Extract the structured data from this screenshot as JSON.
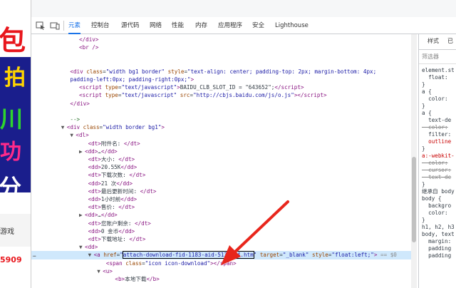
{
  "left_page": {
    "chars": [
      "包",
      "拍",
      "川",
      "功",
      "分"
    ],
    "button": "游戏",
    "number": "5909"
  },
  "toolbar": {
    "tabs": [
      "元素",
      "控制台",
      "源代码",
      "网络",
      "性能",
      "内存",
      "应用程序",
      "安全",
      "Lighthouse"
    ],
    "active": "元素"
  },
  "elements": {
    "lines": [
      {
        "indent": 10,
        "html": "&lt;/div&gt;",
        "type": "tag"
      },
      {
        "indent": 10,
        "html": "&lt;br /&gt;",
        "type": "tag"
      },
      {
        "indent": 0,
        "html": "",
        "type": "blank"
      },
      {
        "indent": 0,
        "html": "",
        "type": "blank"
      },
      {
        "indent": 8,
        "html": "<span class='tag'>&lt;div</span> <span class='attr'>class</span>=<span class='val'>\"width bg1 border\"</span> <span class='attr'>style</span>=<span class='val'>\"text-align: center; padding-top: 2px; margin-bottom: 4px;</span>",
        "type": "raw"
      },
      {
        "indent": 8,
        "html": "<span class='val'>padding-left:0px; padding-right:0px;\"</span><span class='tag'>&gt;</span>",
        "type": "raw"
      },
      {
        "indent": 10,
        "html": "<span class='tag'>&lt;script</span> <span class='attr'>type</span>=<span class='val'>\"text/javascript\"</span><span class='tag'>&gt;</span>BAIDU_CLB_SLOT_ID = \"643652\";<span class='tag'>&lt;/script&gt;</span>",
        "type": "raw"
      },
      {
        "indent": 10,
        "html": "<span class='tag'>&lt;script</span> <span class='attr'>type</span>=<span class='val'>\"text/javascript\"</span> <span class='attr'>src</span>=<span class='val'>\"http://cbjs.baidu.com/js/o.js\"</span><span class='tag'>&gt;&lt;/script&gt;</span>",
        "type": "raw"
      },
      {
        "indent": 8,
        "html": "<span class='tag'>&lt;/div&gt;</span>",
        "type": "raw"
      },
      {
        "indent": 0,
        "html": "",
        "type": "blank"
      },
      {
        "indent": 8,
        "html": "<span class='cmt'>--&gt;</span>",
        "type": "raw"
      },
      {
        "indent": 6,
        "html": "<span class='tri'>▼</span><span class='tag'>&lt;div</span> <span class='attr'>class</span>=<span class='val'>\"width border bg1\"</span><span class='tag'>&gt;</span>",
        "type": "raw"
      },
      {
        "indent": 8,
        "html": "<span class='tri'>▼</span><span class='tag'>&lt;dl&gt;</span>",
        "type": "raw"
      },
      {
        "indent": 12,
        "html": "<span class='tag'>&lt;dt&gt;</span>附件名: <span class='tag'>&lt;/dt&gt;</span>",
        "type": "raw"
      },
      {
        "indent": 10,
        "html": "<span class='tri'>▶</span><span class='tag'>&lt;dd&gt;</span>…<span class='tag'>&lt;/dd&gt;</span>",
        "type": "raw"
      },
      {
        "indent": 12,
        "html": "<span class='tag'>&lt;dt&gt;</span>大小: <span class='tag'>&lt;/dt&gt;</span>",
        "type": "raw"
      },
      {
        "indent": 12,
        "html": "<span class='tag'>&lt;dd&gt;</span>20.55K<span class='tag'>&lt;/dd&gt;</span>",
        "type": "raw"
      },
      {
        "indent": 12,
        "html": "<span class='tag'>&lt;dt&gt;</span>下载次数: <span class='tag'>&lt;/dt&gt;</span>",
        "type": "raw"
      },
      {
        "indent": 12,
        "html": "<span class='tag'>&lt;dd&gt;</span>21 次<span class='tag'>&lt;/dd&gt;</span>",
        "type": "raw"
      },
      {
        "indent": 12,
        "html": "<span class='tag'>&lt;dt&gt;</span>最后更新时间: <span class='tag'>&lt;/dt&gt;</span>",
        "type": "raw"
      },
      {
        "indent": 12,
        "html": "<span class='tag'>&lt;dd&gt;</span>1小时前<span class='tag'>&lt;/dd&gt;</span>",
        "type": "raw"
      },
      {
        "indent": 12,
        "html": "<span class='tag'>&lt;dt&gt;</span>售价: <span class='tag'>&lt;/dt&gt;</span>",
        "type": "raw"
      },
      {
        "indent": 10,
        "html": "<span class='tri'>▶</span><span class='tag'>&lt;dd&gt;</span>…<span class='tag'>&lt;/dd&gt;</span>",
        "type": "raw"
      },
      {
        "indent": 12,
        "html": "<span class='tag'>&lt;dt&gt;</span>您账户剩余: <span class='tag'>&lt;/dt&gt;</span>",
        "type": "raw"
      },
      {
        "indent": 12,
        "html": "<span class='tag'>&lt;dd&gt;</span>0 金币<span class='tag'>&lt;/dd&gt;</span>",
        "type": "raw"
      },
      {
        "indent": 12,
        "html": "<span class='tag'>&lt;dt&gt;</span>下载地址: <span class='tag'>&lt;/dt&gt;</span>",
        "type": "raw"
      },
      {
        "indent": 10,
        "html": "<span class='tri'>▼</span><span class='tag'>&lt;dd&gt;</span>",
        "type": "raw"
      },
      {
        "indent": 12,
        "html": "<span class='tri'>▼</span><span class='tag'>&lt;a</span> <span class='attr'>href</span>=<span class='val'>\"<span class='highlight-box'>attach-download-fid-1183-aid-5138184.htm</span>\"</span> <span class='attr'>target</span>=<span class='val'>\"_blank\"</span> <span class='attr'>style</span>=<span class='val'>\"float:left;\"</span><span class='tag'>&gt;</span> <span style='color:#888'>== $0</span>",
        "type": "selected"
      },
      {
        "indent": 16,
        "html": "<span class='tag'>&lt;span</span> <span class='attr'>class</span>=<span class='val'>\"icon icon-download\"</span><span class='tag'>&gt;&lt;/span&gt;</span>",
        "type": "raw"
      },
      {
        "indent": 14,
        "html": "<span class='tri'>▼</span><span class='tag'>&lt;u&gt;</span>",
        "type": "raw"
      },
      {
        "indent": 18,
        "html": "<span class='tag'>&lt;b&gt;</span>本地下载<span class='tag'>&lt;/b&gt;</span>",
        "type": "raw"
      }
    ]
  },
  "styles": {
    "tabs": [
      "样式",
      "已"
    ],
    "filter_placeholder": "筛选器",
    "lines": [
      "element.st",
      "  float: ",
      "}",
      "a {",
      "  color: ",
      "}",
      "a {",
      "  text-de",
      "  color:",
      "  filter:",
      "  outline",
      "}",
      "a:-webkit-",
      "  color:",
      "  cursor:",
      "  text-de",
      "}",
      "继承自 body",
      "body {",
      "  backgro",
      "  color: ",
      "}",
      "h1, h2, h3",
      "body, text",
      "  margin:",
      "  padding",
      "  padding"
    ]
  }
}
